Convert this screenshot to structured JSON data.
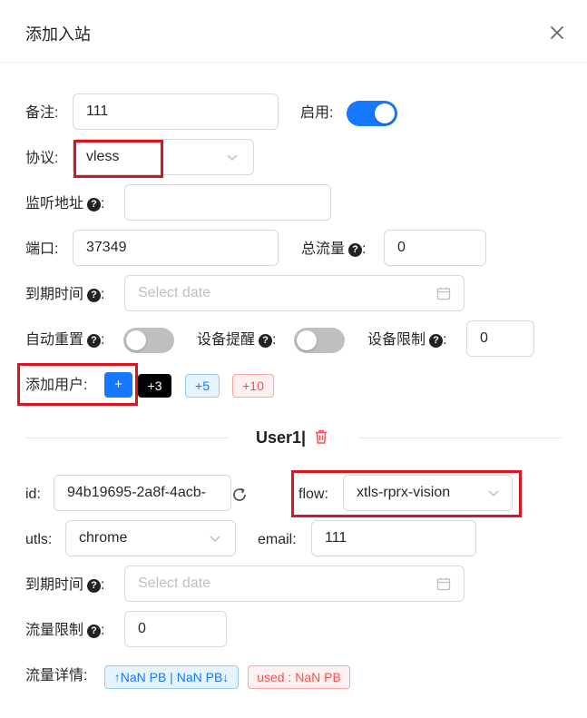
{
  "header": {
    "title": "添加入站"
  },
  "form": {
    "remark": {
      "label": "备注:",
      "value": "111"
    },
    "enable": {
      "label": "启用:",
      "on": true
    },
    "protocol": {
      "label": "协议:",
      "value": "vless"
    },
    "listen": {
      "label": "监听地址",
      "value": ""
    },
    "port": {
      "label": "端口:",
      "value": "37349"
    },
    "total_traffic": {
      "label": "总流量",
      "value": "0"
    },
    "expiry": {
      "label": "到期时间",
      "placeholder": "Select date"
    },
    "auto_reset": {
      "label": "自动重置",
      "on": false
    },
    "device_alert": {
      "label": "设备提醒",
      "on": false
    },
    "device_limit": {
      "label": "设备限制",
      "value": "0"
    },
    "add_user": {
      "label": "添加用户:",
      "plus": "+",
      "tags": [
        "+3",
        "+5",
        "+10"
      ]
    }
  },
  "user": {
    "title": "User1|",
    "id": {
      "label": "id:",
      "value": "94b19695-2a8f-4acb-"
    },
    "flow": {
      "label": "flow:",
      "value": "xtls-rprx-vision"
    },
    "utls": {
      "label": "utls:",
      "value": "chrome"
    },
    "email": {
      "label": "email:",
      "value": "111"
    },
    "expiry": {
      "label": "到期时间",
      "placeholder": "Select date"
    },
    "traffic_limit": {
      "label": "流量限制",
      "value": "0"
    },
    "traffic_detail": {
      "label": "流量详情:",
      "updown": "↑NaN PB | NaN PB↓",
      "used": "used : NaN PB"
    }
  },
  "colors": {
    "primary": "#1677ff",
    "danger": "#ff4d4f",
    "highlight": "#e0121f"
  },
  "icons": [
    "close-icon",
    "question-icon",
    "chevron-down-icon",
    "calendar-icon",
    "refresh-icon",
    "trash-icon"
  ]
}
